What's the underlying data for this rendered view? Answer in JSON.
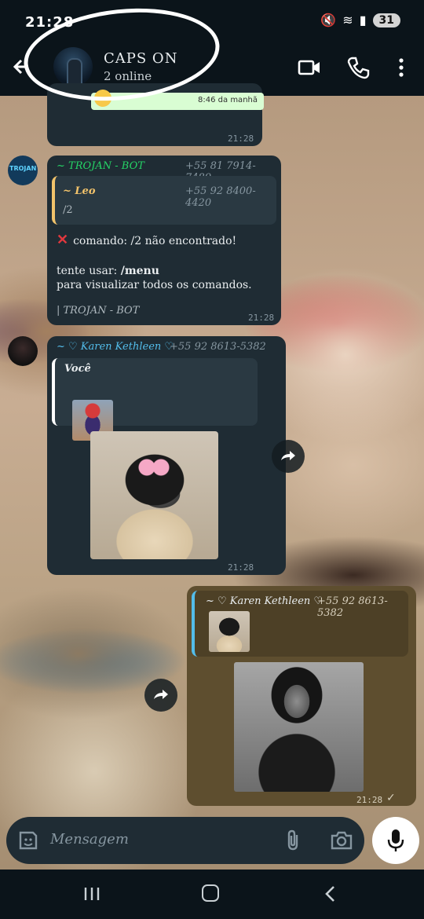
{
  "status_bar": {
    "time": "21:28",
    "battery": "31"
  },
  "header": {
    "title": "CAPS ON",
    "subtitle": "2 online"
  },
  "messages": {
    "previous": {
      "inner_time": "8:46 da manhã",
      "time": "21:28"
    },
    "bot": {
      "sender": "~ TROJAN - BOT",
      "sender_phone": "+55 81 7914-7489",
      "quote_name": "~ Leo",
      "quote_phone": "+55 92 8400-4420",
      "quote_text": "/2",
      "line1": "comando: /2 não encontrado!",
      "line2_prefix": "tente usar: ",
      "line2_cmd": "/menu",
      "line3": "para visualizar todos os comandos.",
      "footer": "| TROJAN - BOT",
      "time": "21:28"
    },
    "karen": {
      "sender": "~ ♡ Karen Kethleen ♡",
      "sender_phone": "+55 92 8613-5382",
      "quote_name": "Você",
      "time": "21:28"
    },
    "outgoing": {
      "quote_name": "~ ♡ Karen Kethleen ♡",
      "quote_phone": "+55 92 8613-5382",
      "time": "21:28"
    }
  },
  "composer": {
    "placeholder": "Mensagem"
  },
  "colors": {
    "header_bg": "#0b141a",
    "incoming_bubble": "#1f2c34",
    "outgoing_bubble": "#5e4e2f",
    "bot_sender": "#25d366",
    "karen_sender": "#53bdeb",
    "error_red": "#e0383e"
  },
  "icons": [
    "back-arrow-icon",
    "video-call-icon",
    "phone-icon",
    "more-vert-icon",
    "forward-icon",
    "sticker-icon",
    "attach-icon",
    "camera-icon",
    "mic-icon",
    "nav-recent-icon",
    "nav-home-icon",
    "nav-back-icon"
  ]
}
